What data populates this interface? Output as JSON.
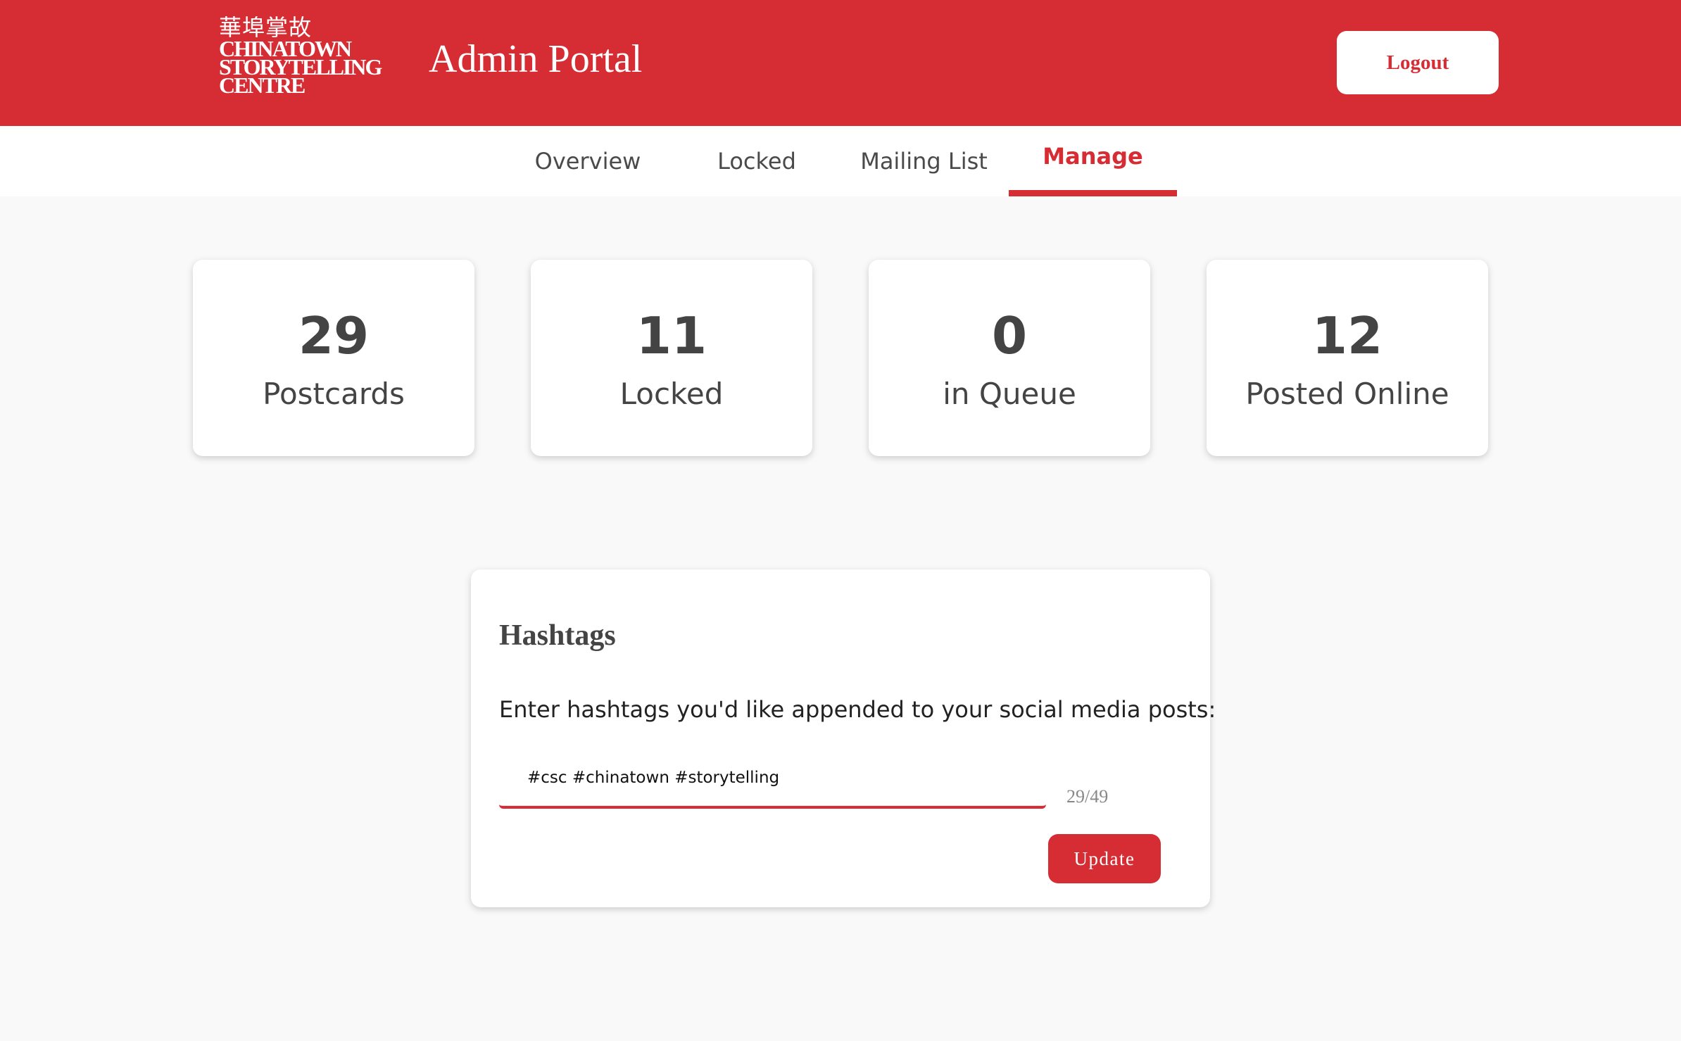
{
  "header": {
    "logo": {
      "cjk": "華埠掌故",
      "line1": "CHINATOWN",
      "line2": "STORYTELLING",
      "line3": "CENTRE"
    },
    "title": "Admin Portal",
    "logout_label": "Logout"
  },
  "tabs": [
    {
      "label": "Overview",
      "active": false
    },
    {
      "label": "Locked",
      "active": false
    },
    {
      "label": "Mailing List",
      "active": false
    },
    {
      "label": "Manage",
      "active": true
    }
  ],
  "stats": [
    {
      "value": "29",
      "label": "Postcards"
    },
    {
      "value": "11",
      "label": "Locked"
    },
    {
      "value": "0",
      "label": "in Queue"
    },
    {
      "value": "12",
      "label": "Posted Online"
    }
  ],
  "hashtags": {
    "title": "Hashtags",
    "description": "Enter hashtags you'd like appended to your social media posts:",
    "input_value": "#csc #chinatown #storytelling",
    "char_count": "29/49",
    "update_label": "Update"
  },
  "colors": {
    "brand_red": "#d62d35",
    "background": "#f9f9f9",
    "card": "#ffffff"
  }
}
